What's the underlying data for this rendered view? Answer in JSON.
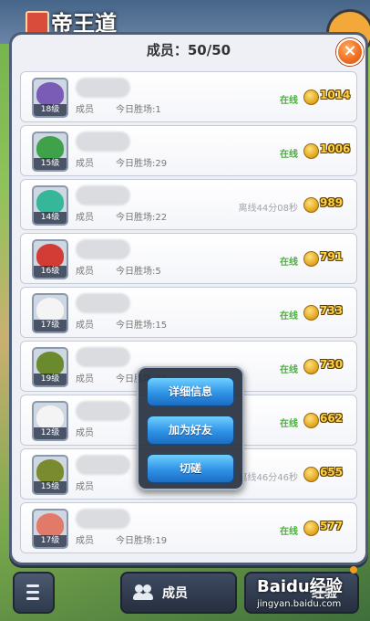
{
  "guild": {
    "name": "帝王道"
  },
  "panel": {
    "title": "成员：50/50",
    "close_label": "×"
  },
  "members": [
    {
      "level": "18级",
      "role": "成员",
      "wins": "今日胜场:1",
      "status": "在线",
      "online": true,
      "coins": "1014",
      "face_color": "#7a5bb5"
    },
    {
      "level": "15级",
      "role": "成员",
      "wins": "今日胜场:29",
      "status": "在线",
      "online": true,
      "coins": "1006",
      "face_color": "#3fa24a"
    },
    {
      "level": "14级",
      "role": "成员",
      "wins": "今日胜场:22",
      "status": "离线44分08秒",
      "online": false,
      "coins": "989",
      "face_color": "#37b79a"
    },
    {
      "level": "16级",
      "role": "成员",
      "wins": "今日胜场:5",
      "status": "在线",
      "online": true,
      "coins": "791",
      "face_color": "#d33b35"
    },
    {
      "level": "17级",
      "role": "成员",
      "wins": "今日胜场:15",
      "status": "在线",
      "online": true,
      "coins": "733",
      "face_color": "#f4f4f4"
    },
    {
      "level": "19级",
      "role": "成员",
      "wins": "今日胜场:24",
      "status": "在线",
      "online": true,
      "coins": "730",
      "face_color": "#6b8a2e"
    },
    {
      "level": "12级",
      "role": "成员",
      "wins": "",
      "status": "在线",
      "online": true,
      "coins": "662",
      "face_color": "#f4f4f4"
    },
    {
      "level": "15级",
      "role": "成员",
      "wins": "",
      "status": "离线46分46秒",
      "online": false,
      "coins": "655",
      "face_color": "#7a8a2e"
    },
    {
      "level": "17级",
      "role": "成员",
      "wins": "今日胜场:19",
      "status": "在线",
      "online": true,
      "coins": "577",
      "face_color": "#e27a6a"
    }
  ],
  "popup_menu": {
    "details": "详细信息",
    "add_friend": "加为好友",
    "spar": "切磋"
  },
  "bottom_bar": {
    "members_tab": "成员",
    "exp_tab": "经验"
  },
  "watermark": {
    "brand": "Baidu经验",
    "url": "jingyan.baidu.com"
  }
}
